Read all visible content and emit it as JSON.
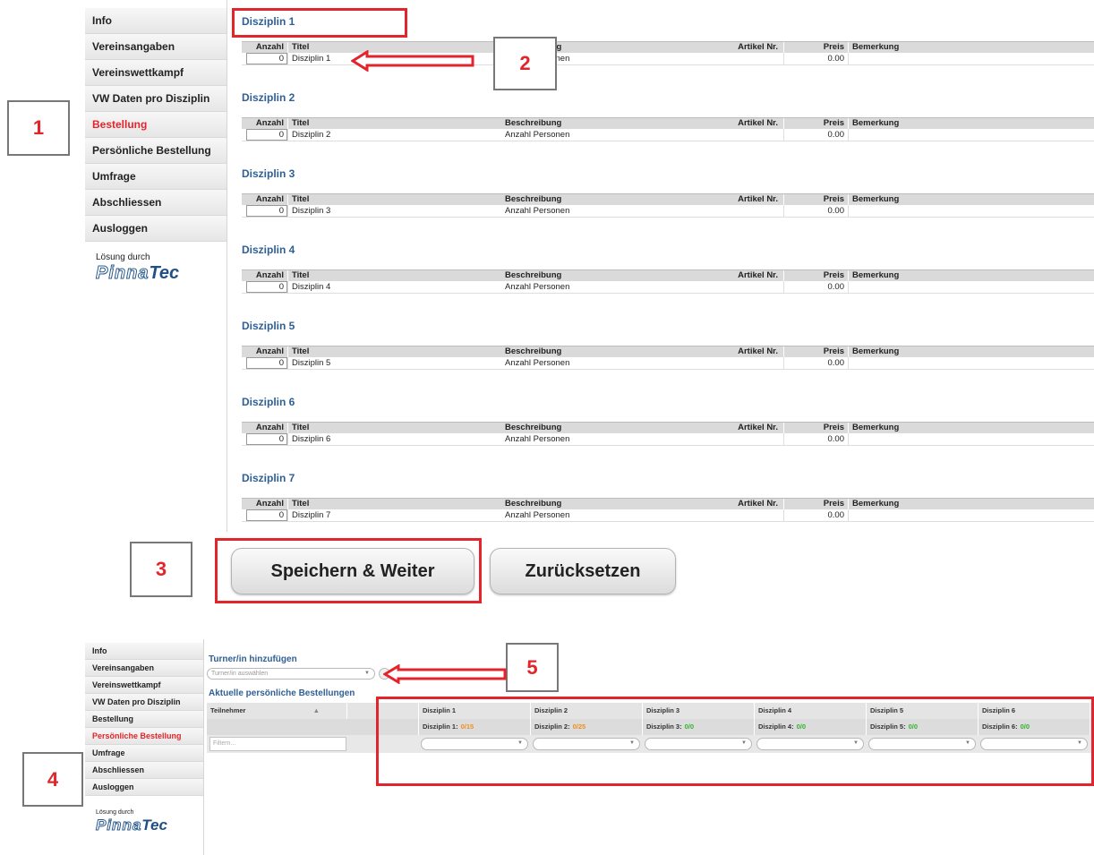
{
  "sidebar": {
    "items": [
      {
        "label": "Info",
        "active": false
      },
      {
        "label": "Vereinsangaben",
        "active": false
      },
      {
        "label": "Vereinswettkampf",
        "active": false
      },
      {
        "label": "VW Daten pro Disziplin",
        "active": false
      },
      {
        "label": "Bestellung",
        "active": true
      },
      {
        "label": "Persönliche Bestellung",
        "active": false
      },
      {
        "label": "Umfrage",
        "active": false
      },
      {
        "label": "Abschliessen",
        "active": false
      },
      {
        "label": "Ausloggen",
        "active": false
      }
    ],
    "solution_label": "Lösung durch",
    "logo_part1": "Pinna",
    "logo_part2": "Tec"
  },
  "table_headers": {
    "qty": "Anzahl",
    "title": "Titel",
    "description": "Beschreibung",
    "article": "Artikel Nr.",
    "price": "Preis",
    "remark": "Bemerkung"
  },
  "disciplines": [
    {
      "heading": "Disziplin 1",
      "qty": "0",
      "title": "Disziplin 1",
      "description": "Anzahl Personen",
      "article": "",
      "price": "0.00",
      "remark": ""
    },
    {
      "heading": "Disziplin 2",
      "qty": "0",
      "title": "Disziplin 2",
      "description": "Anzahl Personen",
      "article": "",
      "price": "0.00",
      "remark": ""
    },
    {
      "heading": "Disziplin 3",
      "qty": "0",
      "title": "Disziplin 3",
      "description": "Anzahl Personen",
      "article": "",
      "price": "0.00",
      "remark": ""
    },
    {
      "heading": "Disziplin 4",
      "qty": "0",
      "title": "Disziplin 4",
      "description": "Anzahl Personen",
      "article": "",
      "price": "0.00",
      "remark": ""
    },
    {
      "heading": "Disziplin 5",
      "qty": "0",
      "title": "Disziplin 5",
      "description": "Anzahl Personen",
      "article": "",
      "price": "0.00",
      "remark": ""
    },
    {
      "heading": "Disziplin 6",
      "qty": "0",
      "title": "Disziplin 6",
      "description": "Anzahl Personen",
      "article": "",
      "price": "0.00",
      "remark": ""
    },
    {
      "heading": "Disziplin 7",
      "qty": "0",
      "title": "Disziplin 7",
      "description": "Anzahl Personen",
      "article": "",
      "price": "0.00",
      "remark": ""
    }
  ],
  "buttons": {
    "save_next": "Speichern & Weiter",
    "reset": "Zurücksetzen"
  },
  "callouts": [
    "1",
    "2",
    "3",
    "4",
    "5"
  ],
  "personal": {
    "add_title": "Turner/in hinzufügen",
    "select_placeholder": "Turner/in auswählen",
    "current_title": "Aktuelle persönliche Bestellungen",
    "participant_header": "Teilnehmer",
    "filter_placeholder": "Filtern...",
    "columns": [
      {
        "name": "Disziplin 1",
        "sub_label": "Disziplin 1:",
        "count": "0/15",
        "status": "orange"
      },
      {
        "name": "Disziplin 2",
        "sub_label": "Disziplin 2:",
        "count": "0/25",
        "status": "orange"
      },
      {
        "name": "Disziplin 3",
        "sub_label": "Disziplin 3:",
        "count": "0/0",
        "status": "green"
      },
      {
        "name": "Disziplin 4",
        "sub_label": "Disziplin 4:",
        "count": "0/0",
        "status": "green"
      },
      {
        "name": "Disziplin 5",
        "sub_label": "Disziplin 5:",
        "count": "0/0",
        "status": "green"
      },
      {
        "name": "Disziplin 6",
        "sub_label": "Disziplin 6:",
        "count": "0/0",
        "status": "green"
      }
    ]
  },
  "colors": {
    "accent_red": "#e2252b",
    "heading_blue": "#2f5f95",
    "warn_orange": "#f28c1e",
    "ok_green": "#32b332"
  }
}
